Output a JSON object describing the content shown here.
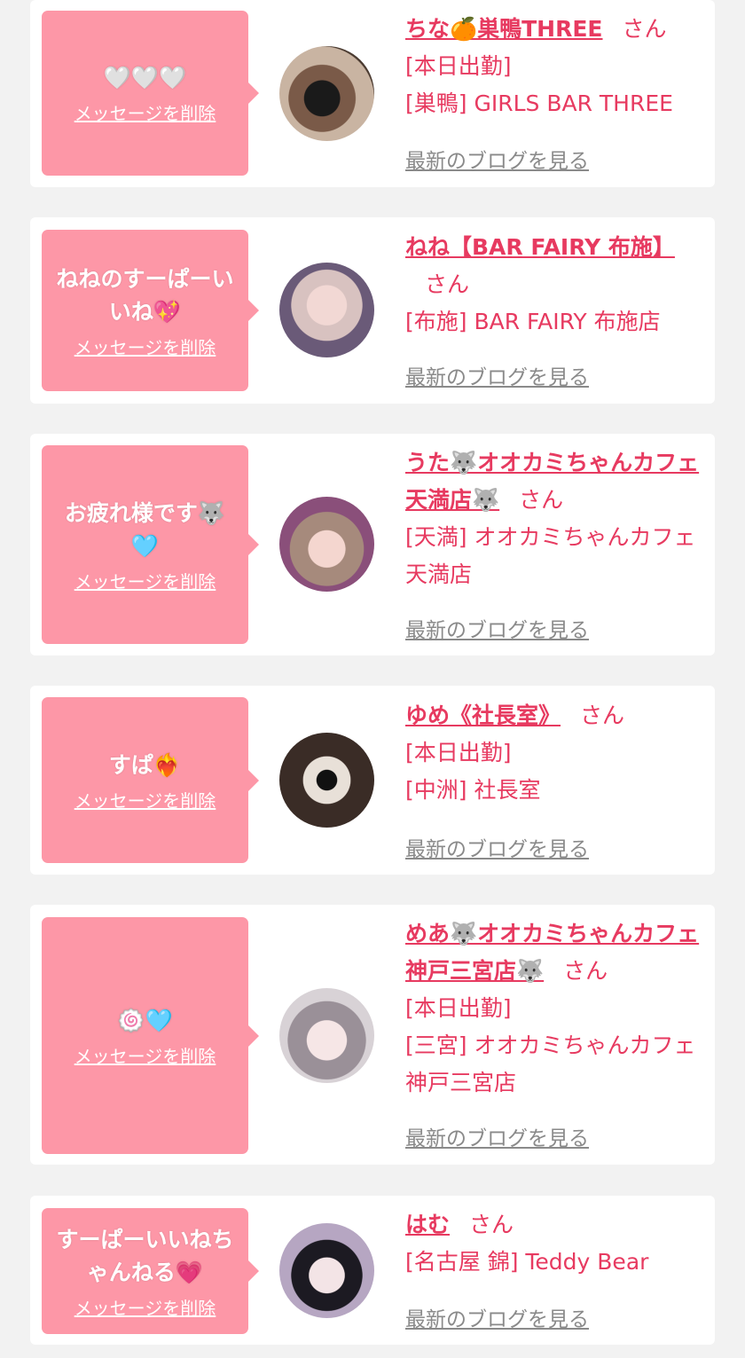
{
  "cards": [
    {
      "message": "🤍🤍🤍",
      "delete_label": "メッセージを削除",
      "name": "ちな🍊巣鴨THREE",
      "honorific": "さん",
      "lines": [
        "[本日出勤]",
        "[巣鴨] GIRLS BAR THREE"
      ],
      "blog_label": "最新のブログを見る"
    },
    {
      "message": "ねねのすーぱーいいね💖",
      "delete_label": "メッセージを削除",
      "name": "ねね【BAR FAIRY 布施】",
      "honorific": "さん",
      "lines": [
        "[布施] BAR FAIRY 布施店"
      ],
      "blog_label": "最新のブログを見る"
    },
    {
      "message": "お疲れ様です🐺🩵",
      "delete_label": "メッセージを削除",
      "name": "うた🐺オオカミちゃんカフェ天満店🐺",
      "honorific": "さん",
      "lines": [
        "[天満] オオカミちゃんカフェ天満店"
      ],
      "blog_label": "最新のブログを見る"
    },
    {
      "message": "すぱ❤️‍🔥",
      "delete_label": "メッセージを削除",
      "name": "ゆめ《社長室》",
      "honorific": "さん",
      "lines": [
        "[本日出勤]",
        "[中洲] 社長室"
      ],
      "blog_label": "最新のブログを見る"
    },
    {
      "message": "🍥🩵",
      "delete_label": "メッセージを削除",
      "name": "めあ🐺オオカミちゃんカフェ神戸三宮店🐺",
      "honorific": "さん",
      "lines": [
        "[本日出勤]",
        "[三宮] オオカミちゃんカフェ神戸三宮店"
      ],
      "blog_label": "最新のブログを見る"
    },
    {
      "message": "すーぱーいいねちゃんねる💗",
      "delete_label": "メッセージを削除",
      "name": "はむ",
      "honorific": "さん",
      "lines": [
        "[名古屋 錦] Teddy Bear"
      ],
      "blog_label": "最新のブログを見る"
    }
  ]
}
